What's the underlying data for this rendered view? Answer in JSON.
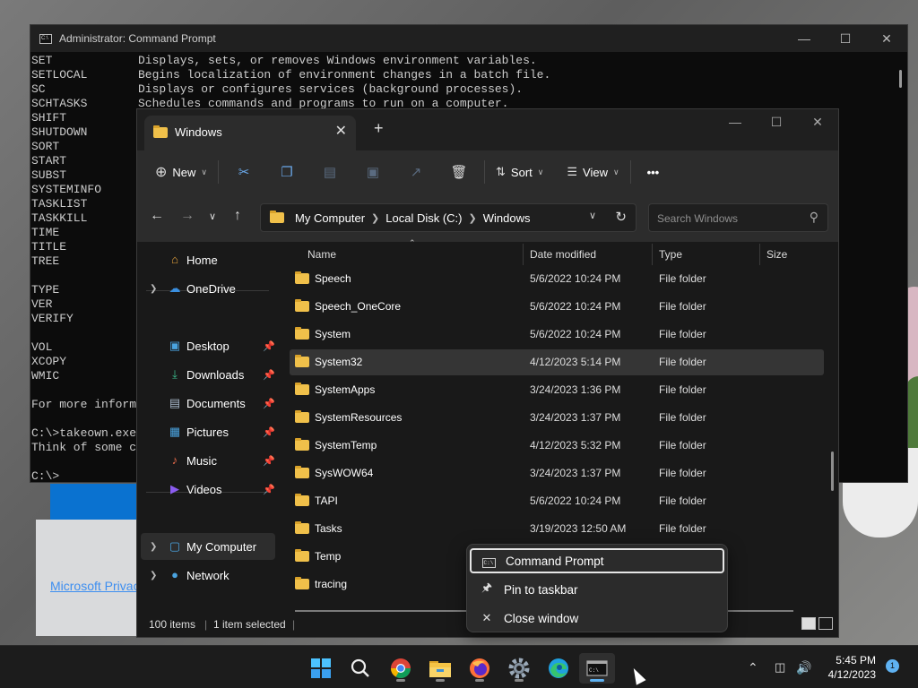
{
  "cmd": {
    "title": "Administrator: Command Prompt",
    "lines": [
      {
        "cmd": "SET",
        "desc": "Displays, sets, or removes Windows environment variables."
      },
      {
        "cmd": "SETLOCAL",
        "desc": "Begins localization of environment changes in a batch file."
      },
      {
        "cmd": "SC",
        "desc": "Displays or configures services (background processes)."
      },
      {
        "cmd": "SCHTASKS",
        "desc": "Schedules commands and programs to run on a computer."
      },
      {
        "cmd": "SHIFT",
        "desc": ""
      },
      {
        "cmd": "SHUTDOWN",
        "desc": ""
      },
      {
        "cmd": "SORT",
        "desc": ""
      },
      {
        "cmd": "START",
        "desc": ""
      },
      {
        "cmd": "SUBST",
        "desc": ""
      },
      {
        "cmd": "SYSTEMINFO",
        "desc": ""
      },
      {
        "cmd": "TASKLIST",
        "desc": ""
      },
      {
        "cmd": "TASKKILL",
        "desc": ""
      },
      {
        "cmd": "TIME",
        "desc": ""
      },
      {
        "cmd": "TITLE",
        "desc": ""
      },
      {
        "cmd": "TREE",
        "desc": ""
      },
      {
        "cmd": "",
        "desc": ""
      },
      {
        "cmd": "TYPE",
        "desc": ""
      },
      {
        "cmd": "VER",
        "desc": ""
      },
      {
        "cmd": "VERIFY",
        "desc": ""
      },
      {
        "cmd": "",
        "desc": ""
      },
      {
        "cmd": "VOL",
        "desc": ""
      },
      {
        "cmd": "XCOPY",
        "desc": ""
      },
      {
        "cmd": "WMIC",
        "desc": ""
      },
      {
        "cmd": "",
        "desc": ""
      },
      {
        "cmd": "For more inform",
        "desc": ""
      },
      {
        "cmd": "",
        "desc": ""
      },
      {
        "cmd": "C:\\>takeown.exe",
        "desc": ""
      },
      {
        "cmd": "Think of some c",
        "desc": ""
      },
      {
        "cmd": "",
        "desc": ""
      },
      {
        "cmd": "C:\\>",
        "desc": ""
      }
    ]
  },
  "background": {
    "link_text": "Microsoft Privac"
  },
  "explorer": {
    "tab_title": "Windows",
    "toolbar": {
      "new_label": "New",
      "sort_label": "Sort",
      "view_label": "View",
      "more_label": "•••"
    },
    "breadcrumb": [
      "My Computer",
      "Local Disk (C:)",
      "Windows"
    ],
    "search_placeholder": "Search Windows",
    "sidebar": [
      {
        "label": "Home",
        "icon": "home-icon",
        "chevron": false,
        "pinned": false
      },
      {
        "label": "OneDrive",
        "icon": "onedrive-icon",
        "chevron": true,
        "pinned": false
      },
      {
        "label": "Desktop",
        "icon": "desktop-icon",
        "chevron": false,
        "pinned": true
      },
      {
        "label": "Downloads",
        "icon": "downloads-icon",
        "chevron": false,
        "pinned": true
      },
      {
        "label": "Documents",
        "icon": "documents-icon",
        "chevron": false,
        "pinned": true
      },
      {
        "label": "Pictures",
        "icon": "pictures-icon",
        "chevron": false,
        "pinned": true
      },
      {
        "label": "Music",
        "icon": "music-icon",
        "chevron": false,
        "pinned": true
      },
      {
        "label": "Videos",
        "icon": "videos-icon",
        "chevron": false,
        "pinned": true
      },
      {
        "label": "My Computer",
        "icon": "computer-icon",
        "chevron": true,
        "pinned": false
      },
      {
        "label": "Network",
        "icon": "network-icon",
        "chevron": true,
        "pinned": false
      }
    ],
    "columns": {
      "name": "Name",
      "date": "Date modified",
      "type": "Type",
      "size": "Size"
    },
    "rows": [
      {
        "name": "Speech",
        "date": "5/6/2022 10:24 PM",
        "type": "File folder"
      },
      {
        "name": "Speech_OneCore",
        "date": "5/6/2022 10:24 PM",
        "type": "File folder"
      },
      {
        "name": "System",
        "date": "5/6/2022 10:24 PM",
        "type": "File folder"
      },
      {
        "name": "System32",
        "date": "4/12/2023 5:14 PM",
        "type": "File folder"
      },
      {
        "name": "SystemApps",
        "date": "3/24/2023 1:36 PM",
        "type": "File folder"
      },
      {
        "name": "SystemResources",
        "date": "3/24/2023 1:37 PM",
        "type": "File folder"
      },
      {
        "name": "SystemTemp",
        "date": "4/12/2023 5:32 PM",
        "type": "File folder"
      },
      {
        "name": "SysWOW64",
        "date": "3/24/2023 1:37 PM",
        "type": "File folder"
      },
      {
        "name": "TAPI",
        "date": "5/6/2022 10:24 PM",
        "type": "File folder"
      },
      {
        "name": "Tasks",
        "date": "3/19/2023 12:50 AM",
        "type": "File folder"
      },
      {
        "name": "Temp",
        "date": "",
        "type": ""
      },
      {
        "name": "tracing",
        "date": "",
        "type": ""
      }
    ],
    "selected_row": "System32",
    "status": {
      "items": "100 items",
      "selected": "1 item selected"
    }
  },
  "context_menu": {
    "items": [
      {
        "label": "Command Prompt",
        "icon": "command-prompt-icon"
      },
      {
        "label": "Pin to taskbar",
        "icon": "pin-icon"
      },
      {
        "label": "Close window",
        "icon": "close-icon"
      }
    ]
  },
  "taskbar": {
    "apps": [
      "start-icon",
      "search-icon",
      "chrome-icon",
      "file-explorer-icon",
      "firefox-icon",
      "settings-icon",
      "edge-icon",
      "terminal-icon"
    ],
    "time": "5:45 PM",
    "date": "4/12/2023",
    "notification_count": "1"
  }
}
